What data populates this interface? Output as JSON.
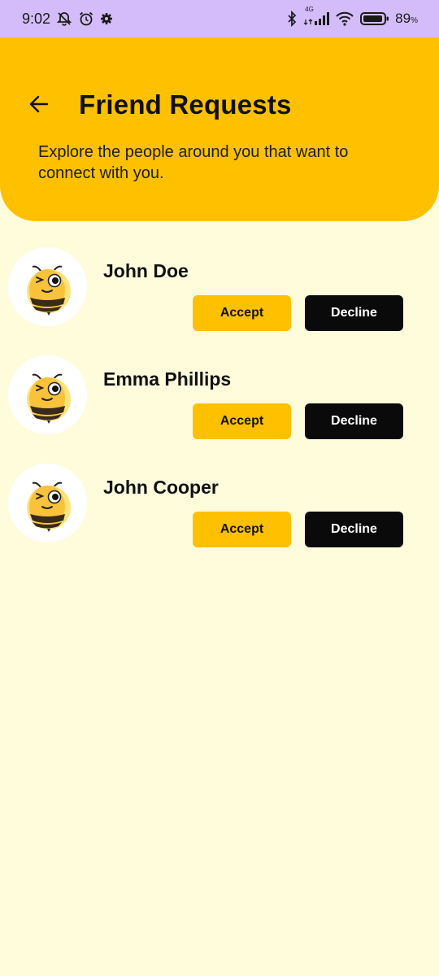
{
  "status_bar": {
    "time": "9:02",
    "battery": "89",
    "battery_unit": "%",
    "network": "4G",
    "icons": [
      "notification-off-icon",
      "alarm-icon",
      "settings-icon",
      "bluetooth-icon",
      "signal-icon",
      "wifi-icon",
      "battery-icon"
    ]
  },
  "header": {
    "title": "Friend Requests",
    "subtitle": "Explore the people around you that want to connect with you.",
    "back_icon": "arrow-left-icon",
    "background": "#ffc000"
  },
  "requests": [
    {
      "name": "John Doe",
      "accept_label": "Accept",
      "decline_label": "Decline",
      "avatar_icon": "bee-avatar-icon"
    },
    {
      "name": "Emma Phillips",
      "accept_label": "Accept",
      "decline_label": "Decline",
      "avatar_icon": "bee-avatar-icon"
    },
    {
      "name": "John Cooper",
      "accept_label": "Accept",
      "decline_label": "Decline",
      "avatar_icon": "bee-avatar-icon"
    }
  ],
  "colors": {
    "page_background": "#fffcdc",
    "accent": "#ffc000",
    "decline_button": "#0a0a0a",
    "status_bar": "#d4bcfa"
  }
}
